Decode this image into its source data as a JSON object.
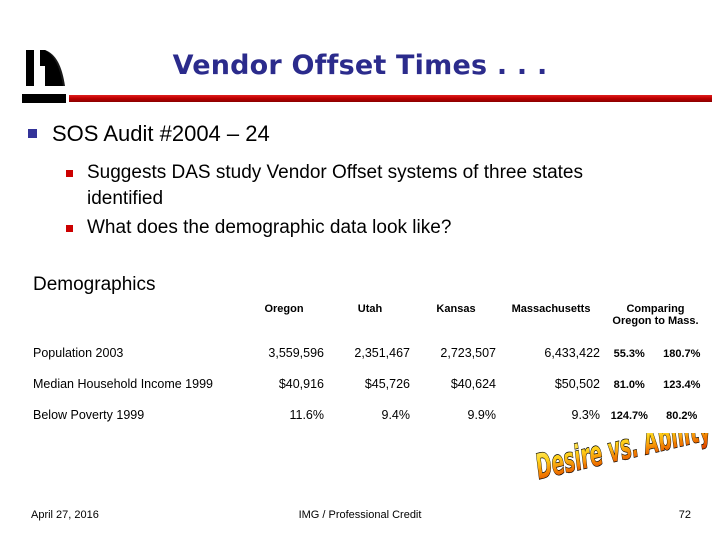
{
  "slide": {
    "title": "Vendor Offset Times . . .",
    "title_color": "#2B2B8C",
    "accent_rule_color": "#C00000",
    "logo_icon": "decay-curve-logo"
  },
  "body": {
    "level1": {
      "marker_color": "#333399",
      "text": "SOS Audit #2004 – 24"
    },
    "level2_marker_color": "#CC0000",
    "level2": [
      {
        "text": "Suggests DAS study Vendor Offset systems of three states identified"
      },
      {
        "text": "What does the demographic data look like?"
      }
    ]
  },
  "demographics": {
    "heading": "Demographics",
    "columns": {
      "label": "",
      "states": [
        "Oregon",
        "Utah",
        "Kansas",
        "Massachusetts"
      ],
      "comparison_header_line1": "Comparing",
      "comparison_header_line2": "Oregon to Mass."
    },
    "rows": [
      {
        "label": "Population 2003",
        "oregon": "3,559,596",
        "utah": "2,351,467",
        "kansas": "2,723,507",
        "massachusetts": "6,433,422",
        "compare_a": "55.3%",
        "compare_b": "180.7%"
      },
      {
        "label": "Median Household Income 1999",
        "oregon": "$40,916",
        "utah": "$45,726",
        "kansas": "$40,624",
        "massachusetts": "$50,502",
        "compare_a": "81.0%",
        "compare_b": "123.4%"
      },
      {
        "label": "Below Poverty 1999",
        "oregon": "11.6%",
        "utah": "9.4%",
        "kansas": "9.9%",
        "massachusetts": "9.3%",
        "compare_a": "124.7%",
        "compare_b": "80.2%"
      }
    ]
  },
  "wordart": {
    "text": "Desire vs. Ability",
    "color_top": "#FFE14D",
    "color_bottom": "#E04A00",
    "outline_color": "#000000"
  },
  "footer": {
    "date": "April 27, 2016",
    "center": "IMG / Professional Credit",
    "page": "72"
  }
}
